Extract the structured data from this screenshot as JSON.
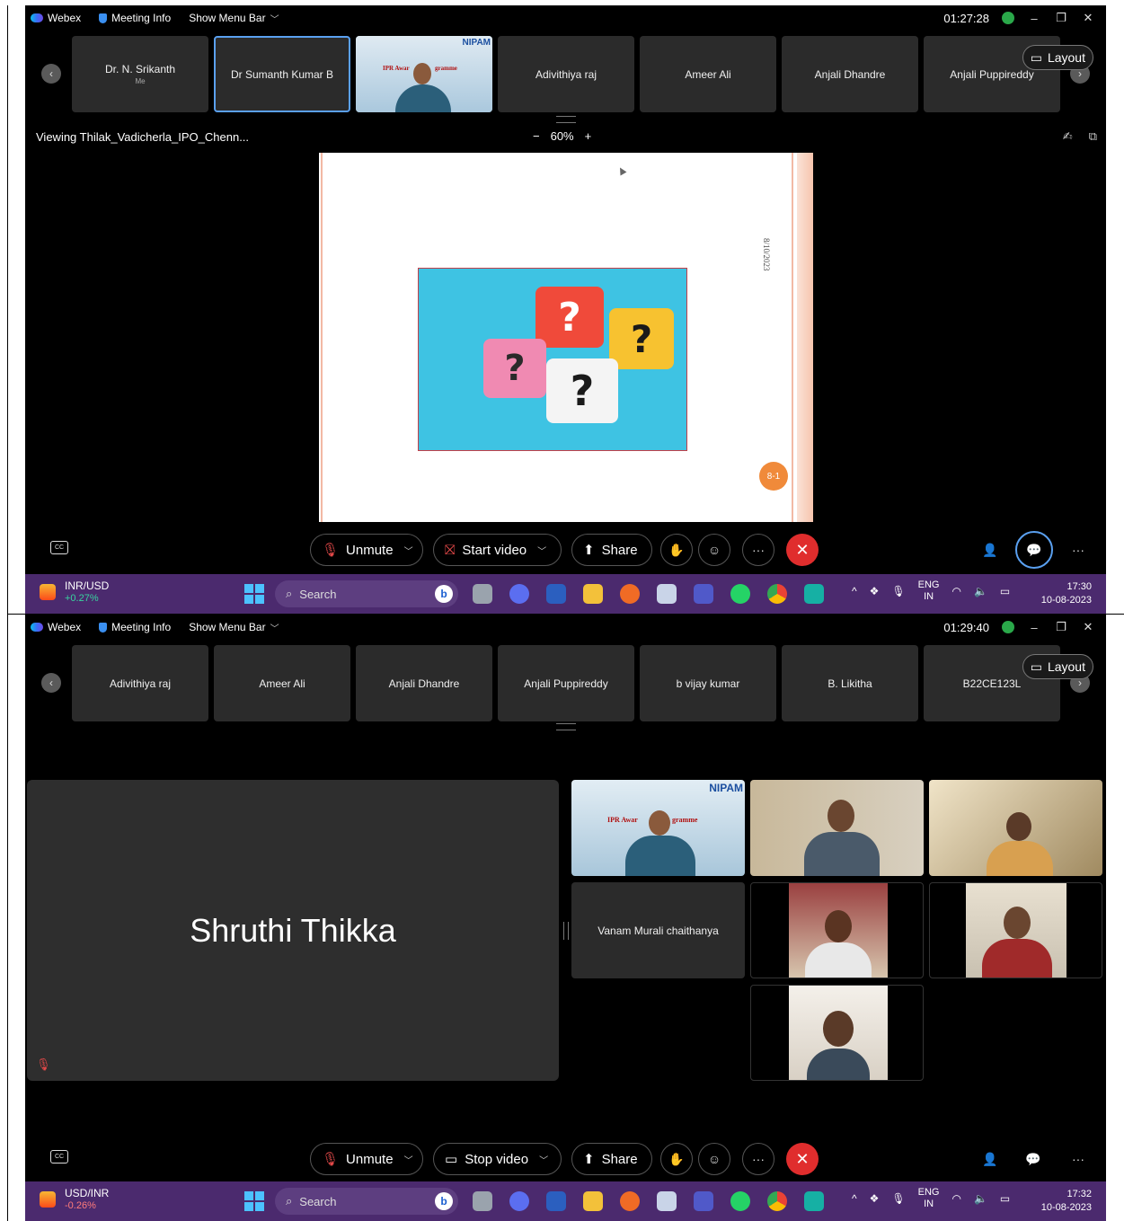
{
  "colors": {
    "accent": "#5aa0f0",
    "leave": "#e02d2d",
    "taskbar": "#4b2a6e",
    "slide_bg": "#3ec3e3"
  },
  "top": {
    "titlebar": {
      "app": "Webex",
      "meeting_info": "Meeting Info",
      "show_menu": "Show Menu Bar",
      "timer": "01:27:28"
    },
    "tiles": [
      {
        "name": "Dr. N. Srikanth",
        "sub": "Me"
      },
      {
        "name": "Dr Sumanth Kumar B"
      },
      {
        "name": ""
      },
      {
        "name": "Adivithiya raj"
      },
      {
        "name": "Ameer Ali"
      },
      {
        "name": "Anjali Dhandre"
      },
      {
        "name": "Anjali Puppireddy"
      }
    ],
    "layout": "Layout",
    "video_sign": "NIPAM",
    "video_sign2": "IPR Awar",
    "video_sign3": "gramme",
    "share_title": "Viewing Thilak_Vadicherla_IPO_Chenn...",
    "zoom_minus": "−",
    "zoom": "60%",
    "zoom_plus": "+",
    "slide": {
      "date": "8/10/2023",
      "page": "8-1",
      "q": "?"
    },
    "controls": {
      "unmute": "Unmute",
      "video": "Start video",
      "share": "Share",
      "more": "···"
    },
    "taskbar": {
      "ticker_name": "INR/USD",
      "ticker_change": "+0.27%",
      "ticker_color": "#38d39f",
      "search": "Search",
      "lang1": "ENG",
      "lang2": "IN",
      "time": "17:30",
      "date": "10-08-2023"
    }
  },
  "bottom": {
    "titlebar": {
      "app": "Webex",
      "meeting_info": "Meeting Info",
      "show_menu": "Show Menu Bar",
      "timer": "01:29:40"
    },
    "tiles": [
      {
        "name": "Adivithiya raj"
      },
      {
        "name": "Ameer Ali"
      },
      {
        "name": "Anjali Dhandre"
      },
      {
        "name": "Anjali Puppireddy"
      },
      {
        "name": "b vijay kumar"
      },
      {
        "name": "B. Likitha"
      },
      {
        "name": "B22CE123L"
      }
    ],
    "layout": "Layout",
    "video_sign": "NIPAM",
    "video_sign2": "IPR Awar",
    "video_sign3": "gramme",
    "active_speaker": "Shruthi Thikka",
    "grid_name_tile": "Vanam Murali chaithanya",
    "controls": {
      "unmute": "Unmute",
      "video": "Stop video",
      "share": "Share",
      "more": "···"
    },
    "taskbar": {
      "ticker_name": "USD/INR",
      "ticker_change": "-0.26%",
      "ticker_color": "#ff7b7b",
      "search": "Search",
      "lang1": "ENG",
      "lang2": "IN",
      "time": "17:32",
      "date": "10-08-2023"
    }
  }
}
